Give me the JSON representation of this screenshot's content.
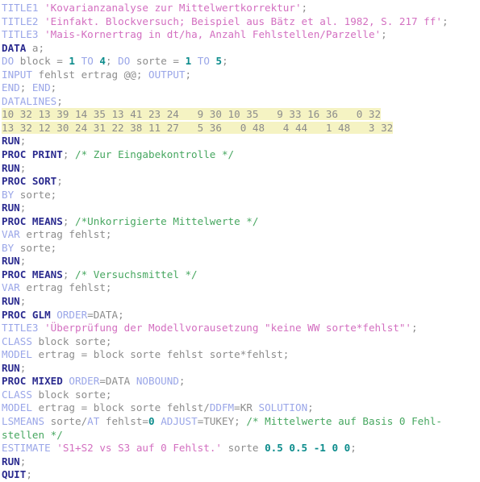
{
  "document": {
    "kind": "sas-code-listing",
    "language": "SAS",
    "background_color": "#ffffff",
    "datalines_highlight_color": "#f5f3c3"
  },
  "colors": {
    "keyword": "#2b2b8f",
    "statement": "#9aa6e8",
    "string": "#d36fc0",
    "comment": "#47a760",
    "number": "#0c8c8c",
    "plain": "#8c8c8c",
    "highlight": "#f5f3c3"
  },
  "lines": [
    {
      "id": "l01",
      "tokens": [
        {
          "t": "stmt",
          "v": "TITLE1"
        },
        {
          "t": "txt",
          "v": " "
        },
        {
          "t": "str",
          "v": "'Kovarianzanalyse zur Mittelwertkorrektur'"
        },
        {
          "t": "txt",
          "v": ";"
        }
      ]
    },
    {
      "id": "l02",
      "tokens": [
        {
          "t": "stmt",
          "v": "TITLE2"
        },
        {
          "t": "txt",
          "v": " "
        },
        {
          "t": "str",
          "v": "'Einfakt. Blockversuch; Beispiel aus Bätz et al. 1982, S. 217 ff'"
        },
        {
          "t": "txt",
          "v": ";"
        }
      ]
    },
    {
      "id": "l03",
      "tokens": [
        {
          "t": "stmt",
          "v": "TITLE3"
        },
        {
          "t": "txt",
          "v": " "
        },
        {
          "t": "str",
          "v": "'Mais-Kornertrag in dt/ha, Anzahl Fehlstellen/Parzelle'"
        },
        {
          "t": "txt",
          "v": ";"
        }
      ]
    },
    {
      "id": "l04",
      "tokens": [
        {
          "t": "kw",
          "v": "DATA"
        },
        {
          "t": "txt",
          "v": " a;"
        }
      ]
    },
    {
      "id": "l05",
      "tokens": [
        {
          "t": "stmt",
          "v": "DO"
        },
        {
          "t": "txt",
          "v": " block = "
        },
        {
          "t": "num",
          "v": "1"
        },
        {
          "t": "txt",
          "v": " "
        },
        {
          "t": "stmt",
          "v": "TO"
        },
        {
          "t": "txt",
          "v": " "
        },
        {
          "t": "num",
          "v": "4"
        },
        {
          "t": "txt",
          "v": "; "
        },
        {
          "t": "stmt",
          "v": "DO"
        },
        {
          "t": "txt",
          "v": " sorte = "
        },
        {
          "t": "num",
          "v": "1"
        },
        {
          "t": "txt",
          "v": " "
        },
        {
          "t": "stmt",
          "v": "TO"
        },
        {
          "t": "txt",
          "v": " "
        },
        {
          "t": "num",
          "v": "5"
        },
        {
          "t": "txt",
          "v": ";"
        }
      ]
    },
    {
      "id": "l06",
      "tokens": [
        {
          "t": "stmt",
          "v": "INPUT"
        },
        {
          "t": "txt",
          "v": " fehlst ertrag @@; "
        },
        {
          "t": "stmt",
          "v": "OUTPUT"
        },
        {
          "t": "txt",
          "v": ";"
        }
      ]
    },
    {
      "id": "l07",
      "tokens": [
        {
          "t": "stmt",
          "v": "END"
        },
        {
          "t": "txt",
          "v": "; "
        },
        {
          "t": "stmt",
          "v": "END"
        },
        {
          "t": "txt",
          "v": ";"
        }
      ]
    },
    {
      "id": "l08",
      "tokens": [
        {
          "t": "stmt",
          "v": "DATALINES"
        },
        {
          "t": "txt",
          "v": ";"
        }
      ]
    },
    {
      "id": "l09",
      "highlight": true,
      "tokens": [
        {
          "t": "dataln",
          "v": "10 32 13 39 14 35 13 41 23 24   9 30 10 35   9 33 16 36   0 32"
        }
      ]
    },
    {
      "id": "l10",
      "highlight": true,
      "tokens": [
        {
          "t": "dataln",
          "v": "13 32 12 30 24 31 22 38 11 27   5 36   0 48   4 44   1 48   3 32"
        }
      ]
    },
    {
      "id": "l11",
      "tokens": [
        {
          "t": "kw",
          "v": "RUN"
        },
        {
          "t": "txt",
          "v": ";"
        }
      ]
    },
    {
      "id": "l12",
      "tokens": [
        {
          "t": "kw",
          "v": "PROC PRINT"
        },
        {
          "t": "txt",
          "v": "; "
        },
        {
          "t": "cmt",
          "v": "/* Zur Eingabekontrolle */"
        }
      ]
    },
    {
      "id": "l13",
      "tokens": [
        {
          "t": "kw",
          "v": "RUN"
        },
        {
          "t": "txt",
          "v": ";"
        }
      ]
    },
    {
      "id": "l14",
      "tokens": [
        {
          "t": "kw",
          "v": "PROC SORT"
        },
        {
          "t": "txt",
          "v": ";"
        }
      ]
    },
    {
      "id": "l15",
      "tokens": [
        {
          "t": "stmt",
          "v": "BY"
        },
        {
          "t": "txt",
          "v": " sorte;"
        }
      ]
    },
    {
      "id": "l16",
      "tokens": [
        {
          "t": "kw",
          "v": "RUN"
        },
        {
          "t": "txt",
          "v": ";"
        }
      ]
    },
    {
      "id": "l17",
      "tokens": [
        {
          "t": "kw",
          "v": "PROC MEANS"
        },
        {
          "t": "txt",
          "v": "; "
        },
        {
          "t": "cmt",
          "v": "/*Unkorrigierte Mittelwerte */"
        }
      ]
    },
    {
      "id": "l18",
      "tokens": [
        {
          "t": "stmt",
          "v": "VAR"
        },
        {
          "t": "txt",
          "v": " ertrag fehlst;"
        }
      ]
    },
    {
      "id": "l19",
      "tokens": [
        {
          "t": "stmt",
          "v": "BY"
        },
        {
          "t": "txt",
          "v": " sorte;"
        }
      ]
    },
    {
      "id": "l20",
      "tokens": [
        {
          "t": "kw",
          "v": "RUN"
        },
        {
          "t": "txt",
          "v": ";"
        }
      ]
    },
    {
      "id": "l21",
      "tokens": [
        {
          "t": "kw",
          "v": "PROC MEANS"
        },
        {
          "t": "txt",
          "v": "; "
        },
        {
          "t": "cmt",
          "v": "/* Versuchsmittel */"
        }
      ]
    },
    {
      "id": "l22",
      "tokens": [
        {
          "t": "stmt",
          "v": "VAR"
        },
        {
          "t": "txt",
          "v": " ertrag fehlst;"
        }
      ]
    },
    {
      "id": "l23",
      "tokens": [
        {
          "t": "kw",
          "v": "RUN"
        },
        {
          "t": "txt",
          "v": ";"
        }
      ]
    },
    {
      "id": "l24",
      "tokens": [
        {
          "t": "kw",
          "v": "PROC GLM"
        },
        {
          "t": "txt",
          "v": " "
        },
        {
          "t": "opt",
          "v": "ORDER"
        },
        {
          "t": "txt",
          "v": "=DATA;"
        }
      ]
    },
    {
      "id": "l25",
      "tokens": [
        {
          "t": "stmt",
          "v": "TITLE3"
        },
        {
          "t": "txt",
          "v": " "
        },
        {
          "t": "str",
          "v": "'Überprüfung der Modellvorausetzung \"keine WW sorte*fehlst\"'"
        },
        {
          "t": "txt",
          "v": ";"
        }
      ]
    },
    {
      "id": "l26",
      "tokens": [
        {
          "t": "stmt",
          "v": "CLASS"
        },
        {
          "t": "txt",
          "v": " block sorte;"
        }
      ]
    },
    {
      "id": "l27",
      "tokens": [
        {
          "t": "stmt",
          "v": "MODEL"
        },
        {
          "t": "txt",
          "v": " ertrag = block sorte fehlst sorte*fehlst;"
        }
      ]
    },
    {
      "id": "l28",
      "tokens": [
        {
          "t": "kw",
          "v": "RUN"
        },
        {
          "t": "txt",
          "v": ";"
        }
      ]
    },
    {
      "id": "l29",
      "tokens": [
        {
          "t": "kw",
          "v": "PROC MIXED"
        },
        {
          "t": "txt",
          "v": " "
        },
        {
          "t": "opt",
          "v": "ORDER"
        },
        {
          "t": "txt",
          "v": "=DATA "
        },
        {
          "t": "opt",
          "v": "NOBOUND"
        },
        {
          "t": "txt",
          "v": ";"
        }
      ]
    },
    {
      "id": "l30",
      "tokens": [
        {
          "t": "stmt",
          "v": "CLASS"
        },
        {
          "t": "txt",
          "v": " block sorte;"
        }
      ]
    },
    {
      "id": "l31",
      "tokens": [
        {
          "t": "stmt",
          "v": "MODEL"
        },
        {
          "t": "txt",
          "v": " ertrag = block sorte fehlst/"
        },
        {
          "t": "opt",
          "v": "DDFM"
        },
        {
          "t": "txt",
          "v": "=KR "
        },
        {
          "t": "opt",
          "v": "SOLUTION"
        },
        {
          "t": "txt",
          "v": ";"
        }
      ]
    },
    {
      "id": "l32",
      "tokens": [
        {
          "t": "stmt",
          "v": "LSMEANS"
        },
        {
          "t": "txt",
          "v": " sorte/"
        },
        {
          "t": "opt",
          "v": "AT"
        },
        {
          "t": "txt",
          "v": " fehlst="
        },
        {
          "t": "num",
          "v": "0"
        },
        {
          "t": "txt",
          "v": " "
        },
        {
          "t": "opt",
          "v": "ADJUST"
        },
        {
          "t": "txt",
          "v": "=TUKEY; "
        },
        {
          "t": "cmt",
          "v": "/* Mittelwerte auf Basis 0 Fehl-"
        }
      ]
    },
    {
      "id": "l33",
      "tokens": [
        {
          "t": "cmt",
          "v": "stellen */"
        }
      ]
    },
    {
      "id": "l34",
      "tokens": [
        {
          "t": "stmt",
          "v": "ESTIMATE"
        },
        {
          "t": "txt",
          "v": " "
        },
        {
          "t": "str",
          "v": "'S1+S2 vs S3 auf 0 Fehlst.'"
        },
        {
          "t": "txt",
          "v": " sorte "
        },
        {
          "t": "num",
          "v": "0.5 0.5 -1 0 0"
        },
        {
          "t": "txt",
          "v": ";"
        }
      ]
    },
    {
      "id": "l35",
      "tokens": [
        {
          "t": "kw",
          "v": "RUN"
        },
        {
          "t": "txt",
          "v": ";"
        }
      ]
    },
    {
      "id": "l36",
      "tokens": [
        {
          "t": "kw",
          "v": "QUIT"
        },
        {
          "t": "txt",
          "v": ";"
        }
      ]
    }
  ]
}
